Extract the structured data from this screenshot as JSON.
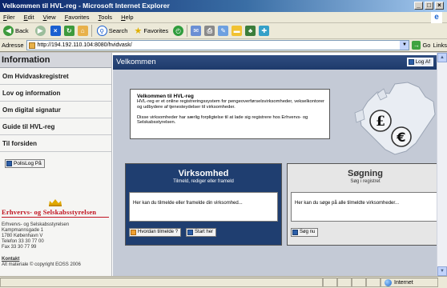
{
  "browser": {
    "title": "Velkommen til HVL-reg - Microsoft Internet Explorer",
    "menu": [
      "Filer",
      "Edit",
      "View",
      "Favorites",
      "Tools",
      "Help"
    ],
    "toolbar": {
      "back": "Back",
      "search": "Search",
      "favorites": "Favorites"
    },
    "address_label": "Adresse",
    "address_value": "http://194.192.110.104:8080/hvidvask/",
    "go_label": "Go",
    "links_label": "Links",
    "status_zone": "Internet"
  },
  "sidebar": {
    "header": "Information",
    "nav_items": [
      "Om Hvidvaskregistret",
      "Lov og information",
      "Om digital signatur",
      "Guide til HVL-reg",
      "Til forsiden"
    ],
    "logout_button": "PolisLog På",
    "org_name": "Erhvervs- og Selskabsstyrelsen",
    "address_lines": [
      "Erhvervs- og Selskabsstyrelsen",
      "Kampmannsgade 1",
      "1780 København V",
      "Telefon 33 30 77 00",
      "Fax 33 30 77 99"
    ],
    "contact_link": "Kontakt",
    "copyright": "Alt materiale © copyright EOSS 2006"
  },
  "main": {
    "header_title": "Velkommen",
    "logout_button": "Log Af",
    "welcome": {
      "title": "Velkommen til HVL-reg",
      "paragraph1": "HVL-reg er et online registreringssystem for pengeoverførselsvirksomheder, vekselkontorer og udbydere af tjenesteydelser til virksomheder.",
      "paragraph2": "Disse virksomheder har særlig forpligtelse til at lade sig registrere hos Erhvervs- og Selskabsstyrelsen."
    },
    "cards": {
      "virksomhed": {
        "title": "Virksomhed",
        "subtitle": "Tilmeld, rediger eller frameld",
        "body": "Her kan du tilmelde eller framelde din virksomhed...",
        "button_help": "Hvordan tilmelde ?",
        "button_start": "Start her"
      },
      "sogning": {
        "title": "Søgning",
        "subtitle": "Søg i registret",
        "body": "Her kan du søge på alle tilmeldte virksomheder...",
        "button_search": "Søg nu"
      }
    }
  },
  "colors": {
    "header_blue": "#1e3a6b",
    "content_bg": "#c4cad6",
    "brand_red": "#c1121f"
  }
}
